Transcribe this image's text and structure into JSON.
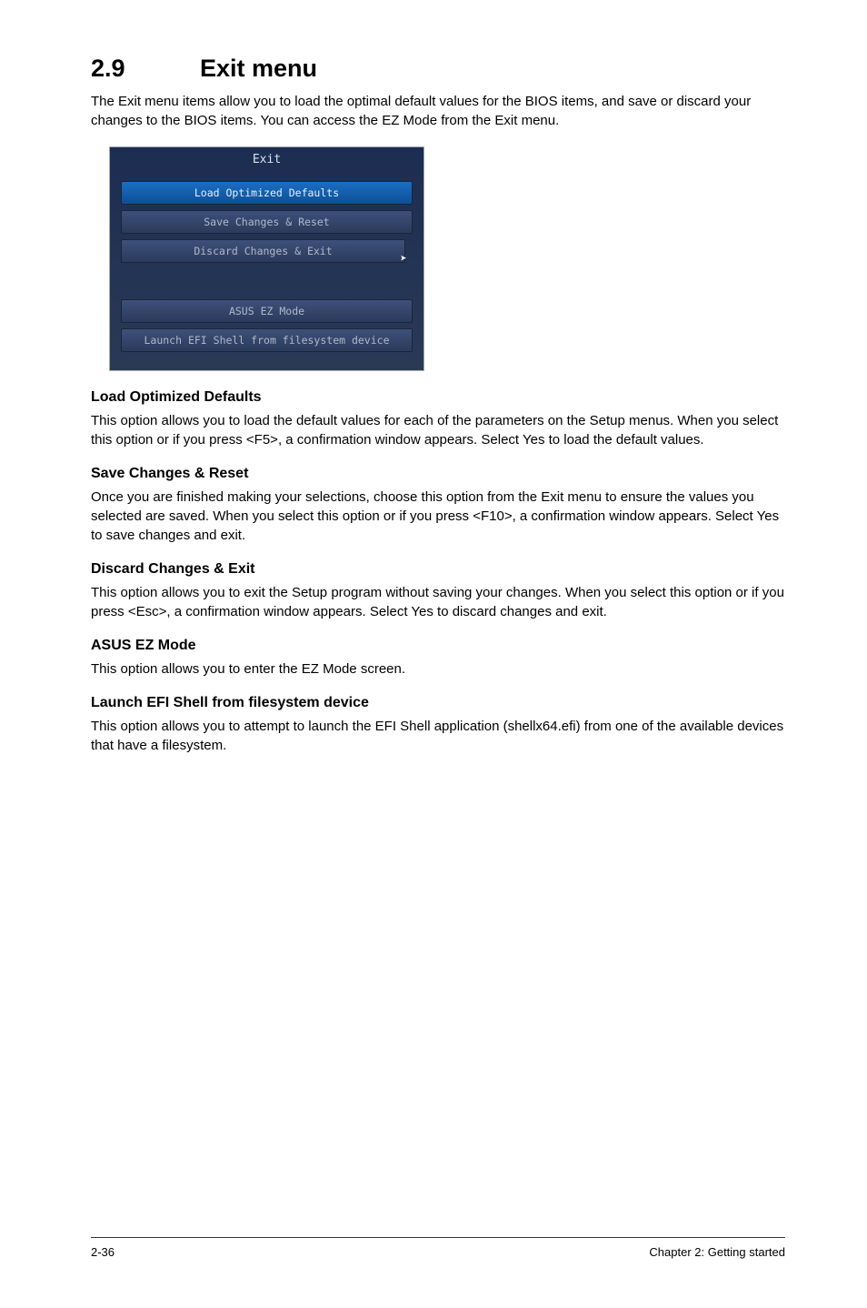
{
  "section": {
    "number": "2.9",
    "title": "Exit menu",
    "intro": "The Exit menu items allow you to load the optimal default values for the BIOS items, and save or discard your changes to the BIOS items. You can access the EZ Mode from the Exit menu."
  },
  "screenshot": {
    "title": "Exit",
    "items": [
      "Load Optimized Defaults",
      "Save Changes & Reset",
      "Discard Changes & Exit",
      "ASUS EZ Mode",
      "Launch EFI Shell from filesystem device"
    ]
  },
  "subsections": [
    {
      "heading": "Load Optimized Defaults",
      "text": "This option allows you to load the default values for each of the parameters on the Setup menus. When you select this option or if you press <F5>, a confirmation window appears. Select Yes to load the default values."
    },
    {
      "heading": "Save Changes & Reset",
      "text": "Once you are finished making your selections, choose this option from the Exit menu to ensure the values you selected are saved. When you select this option or if you press <F10>, a confirmation window appears. Select Yes to save changes and exit."
    },
    {
      "heading": "Discard Changes & Exit",
      "text": "This option allows you to exit the Setup program without saving your changes. When you select this option or if you press <Esc>, a confirmation window appears. Select Yes to discard changes and exit."
    },
    {
      "heading": "ASUS EZ Mode",
      "text": "This option allows you to enter the EZ Mode screen."
    },
    {
      "heading": "Launch EFI Shell from filesystem device",
      "text": "This option allows you to attempt to launch the EFI Shell application (shellx64.efi) from one of the available devices that have a filesystem."
    }
  ],
  "footer": {
    "left": "2-36",
    "right": "Chapter 2: Getting started"
  }
}
